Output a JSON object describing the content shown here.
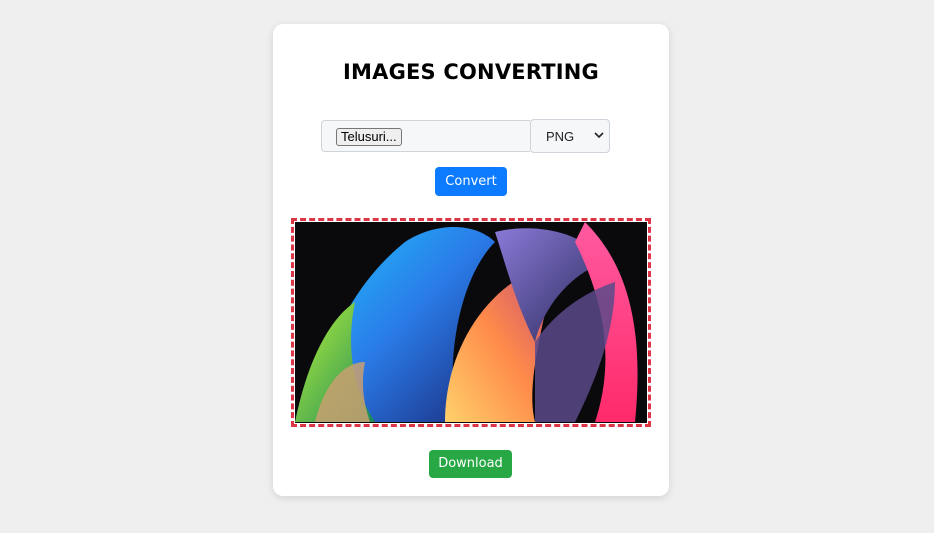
{
  "header": {
    "title": "IMAGES CONVERTING"
  },
  "form": {
    "file_button_label": "Telusuri...",
    "format_selected": "PNG",
    "convert_label": "Convert"
  },
  "preview": {
    "image_description": ""
  },
  "actions": {
    "download_label": "Download"
  },
  "colors": {
    "background": "#efefef",
    "card": "#ffffff",
    "convert_button": "#0d7bff",
    "download_button": "#28a745",
    "preview_border": "#dc3545"
  }
}
